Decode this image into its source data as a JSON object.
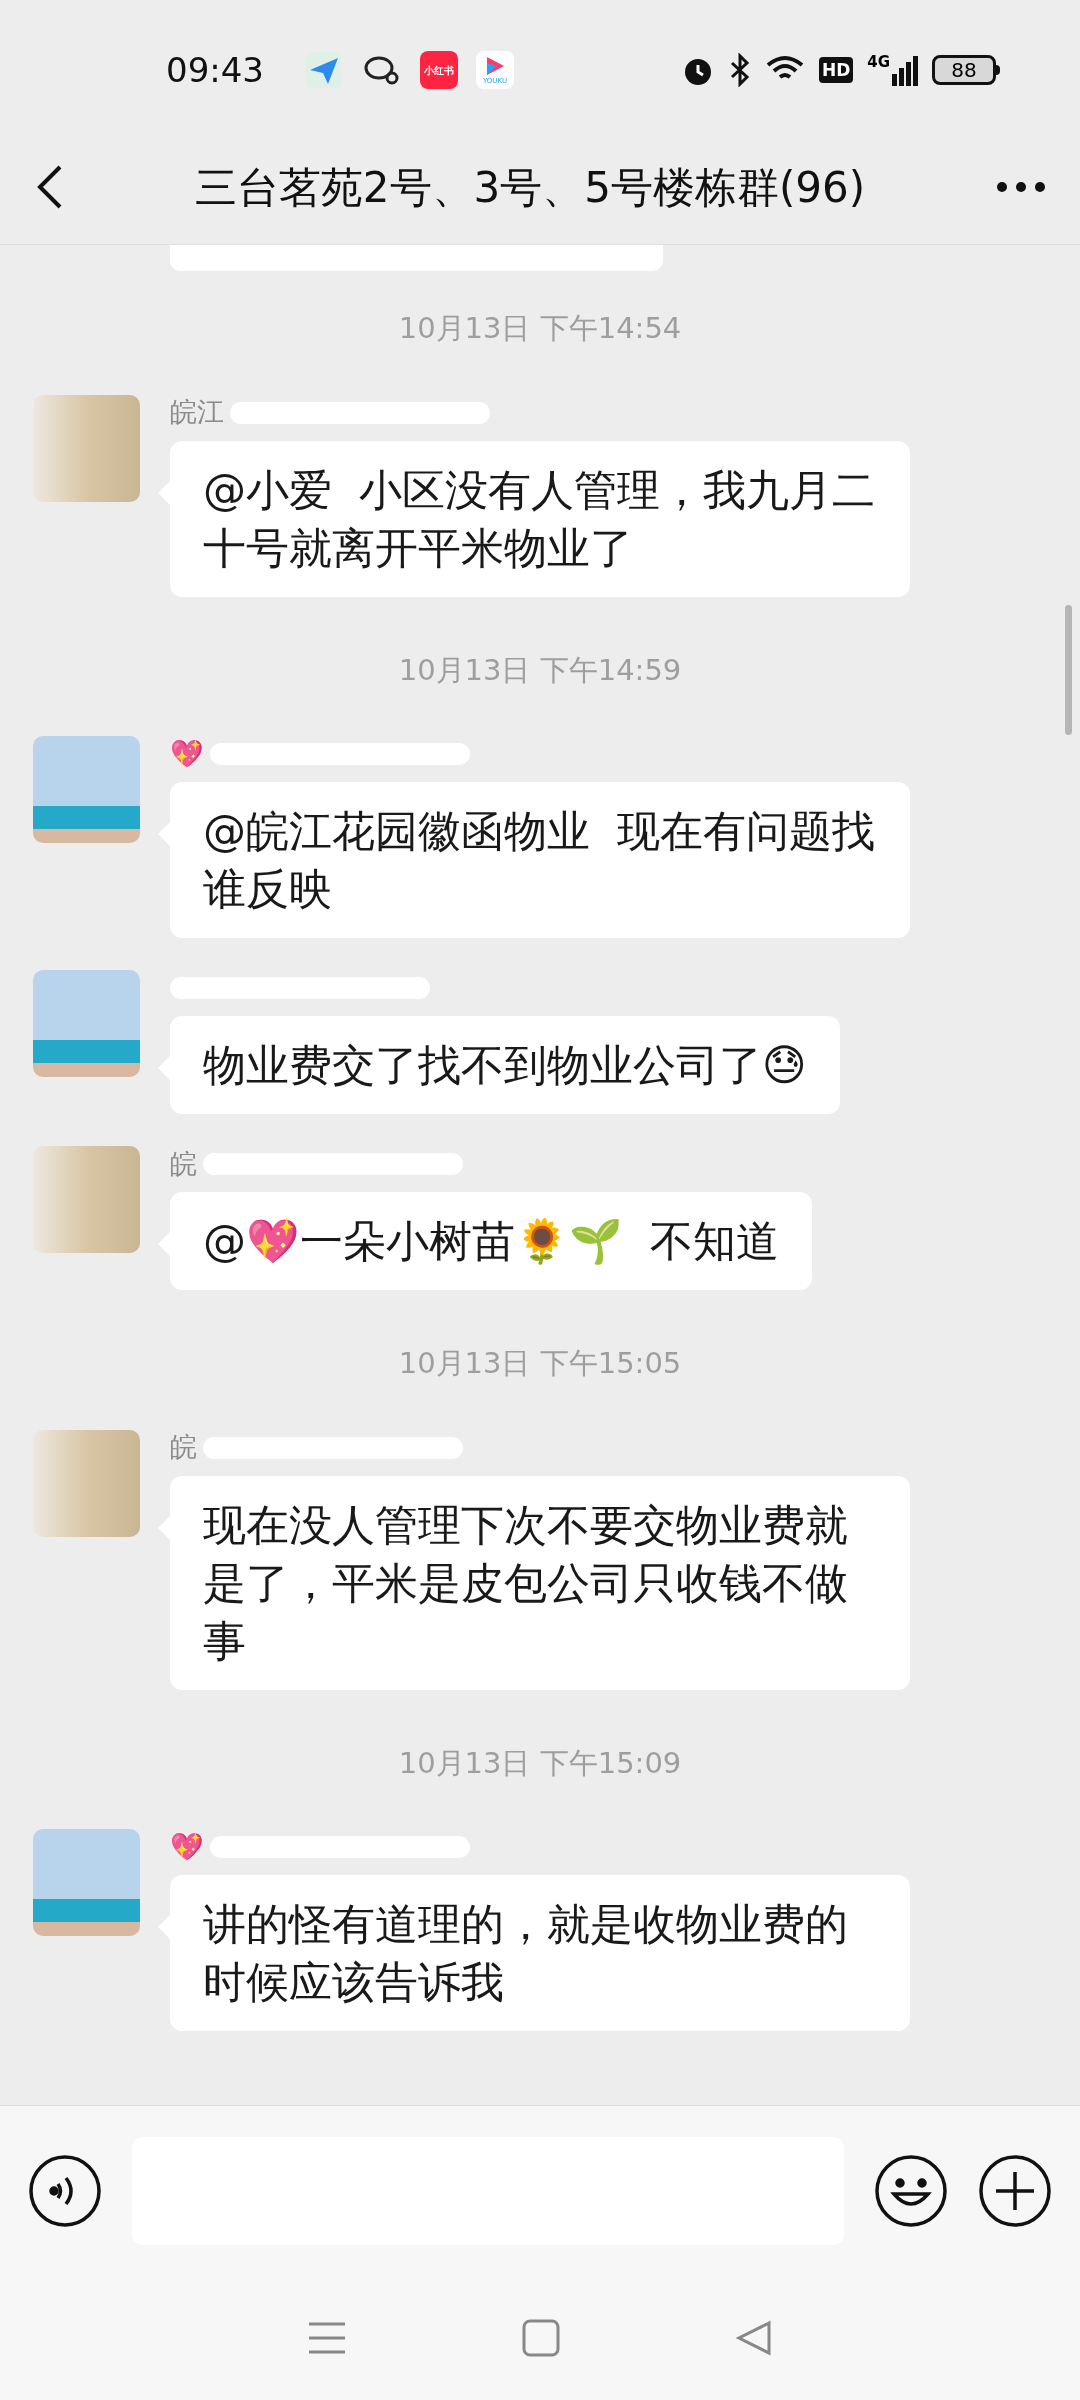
{
  "status_bar": {
    "time": "09:43",
    "app_icons": [
      {
        "kind": "plane"
      },
      {
        "kind": "chat"
      },
      {
        "kind": "badge",
        "label": "小红书"
      },
      {
        "kind": "video",
        "label": "YOUKU"
      }
    ],
    "hd": "HD",
    "network": "4G",
    "battery": "88"
  },
  "header": {
    "title": "三台茗苑2号、3号、5号楼栋群(96)"
  },
  "messages": [
    {
      "kind": "partial"
    },
    {
      "kind": "time",
      "text": "10月13日 下午14:54"
    },
    {
      "kind": "message",
      "avatar": {
        "kind": "photo"
      },
      "sender": "皖江",
      "text": "@小爱  小区没有人管理，我九月二十号就离开平米物业了"
    },
    {
      "kind": "time",
      "text": "10月13日 下午14:59"
    },
    {
      "kind": "message",
      "avatar": {
        "kind": "illustration"
      },
      "sender": "💖",
      "text": "@皖江花园徽函物业  现在有问题找谁反映"
    },
    {
      "kind": "message",
      "avatar": {
        "kind": "illustration"
      },
      "text": "物业费交了找不到物业公司了😓"
    },
    {
      "kind": "message",
      "avatar": {
        "kind": "photo"
      },
      "sender": "皖",
      "text": "@💖一朵小树苗🌻🌱  不知道"
    },
    {
      "kind": "time",
      "text": "10月13日 下午15:05"
    },
    {
      "kind": "message",
      "avatar": {
        "kind": "photo"
      },
      "sender": "皖",
      "text": "现在没人管理下次不要交物业费就是了，平米是皮包公司只收钱不做事"
    },
    {
      "kind": "time",
      "text": "10月13日 下午15:09"
    },
    {
      "kind": "message",
      "avatar": {
        "kind": "illustration"
      },
      "sender": "💖",
      "text": "讲的怪有道理的，就是收物业费的时候应该告诉我"
    }
  ]
}
